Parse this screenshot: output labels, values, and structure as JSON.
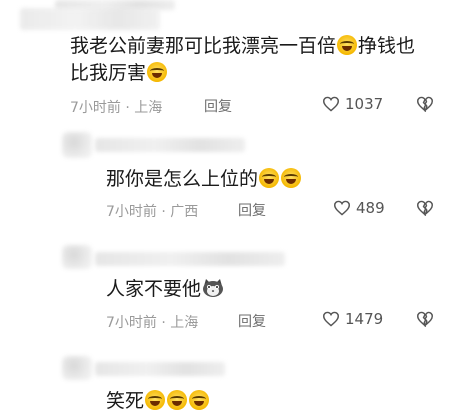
{
  "comments": [
    {
      "text_lines": [
        "我老公前妻那可比我漂亮一百倍",
        "挣钱也",
        "比我厉害"
      ],
      "time": "7小时前",
      "location": "上海",
      "reply_label": "回复",
      "likes": "1037"
    },
    {
      "text": "那你是怎么上位的",
      "time": "7小时前",
      "location": "广西",
      "reply_label": "回复",
      "likes": "489"
    },
    {
      "text": "人家不要他",
      "time": "7小时前",
      "location": "上海",
      "reply_label": "回复",
      "likes": "1479"
    },
    {
      "text": "笑死"
    }
  ],
  "separator": "·",
  "icons": {
    "emoji": "laughing-tears-emoji",
    "cat": "cat-emoji",
    "like": "heart-outline-icon",
    "dislike": "broken-heart-icon"
  }
}
